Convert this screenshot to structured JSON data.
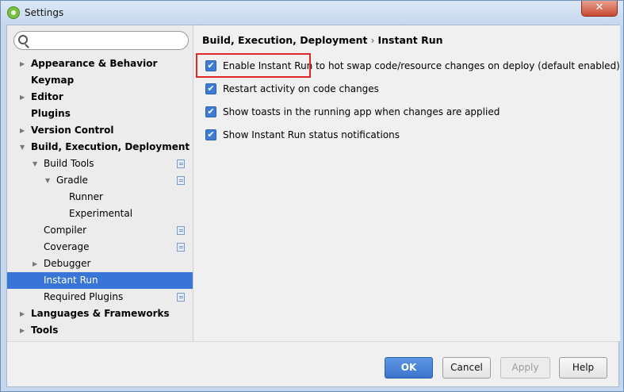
{
  "window": {
    "title": "Settings",
    "close_glyph": "✕"
  },
  "search": {
    "value": "",
    "placeholder": ""
  },
  "tree": [
    {
      "label": "Appearance & Behavior",
      "bold": true,
      "arrow": "▶",
      "indent": 0,
      "page_icon": false,
      "selected": false
    },
    {
      "label": "Keymap",
      "bold": true,
      "arrow": "",
      "indent": 0,
      "page_icon": false,
      "selected": false
    },
    {
      "label": "Editor",
      "bold": true,
      "arrow": "▶",
      "indent": 0,
      "page_icon": false,
      "selected": false
    },
    {
      "label": "Plugins",
      "bold": true,
      "arrow": "",
      "indent": 0,
      "page_icon": false,
      "selected": false
    },
    {
      "label": "Version Control",
      "bold": true,
      "arrow": "▶",
      "indent": 0,
      "page_icon": false,
      "selected": false
    },
    {
      "label": "Build, Execution, Deployment",
      "bold": true,
      "arrow": "▼",
      "indent": 0,
      "page_icon": false,
      "selected": false
    },
    {
      "label": "Build Tools",
      "bold": false,
      "arrow": "▼",
      "indent": 1,
      "page_icon": true,
      "selected": false
    },
    {
      "label": "Gradle",
      "bold": false,
      "arrow": "▼",
      "indent": 2,
      "page_icon": true,
      "selected": false
    },
    {
      "label": "Runner",
      "bold": false,
      "arrow": "",
      "indent": 3,
      "page_icon": false,
      "selected": false
    },
    {
      "label": "Experimental",
      "bold": false,
      "arrow": "",
      "indent": 3,
      "page_icon": false,
      "selected": false
    },
    {
      "label": "Compiler",
      "bold": false,
      "arrow": "",
      "indent": 1,
      "page_icon": true,
      "selected": false
    },
    {
      "label": "Coverage",
      "bold": false,
      "arrow": "",
      "indent": 1,
      "page_icon": true,
      "selected": false
    },
    {
      "label": "Debugger",
      "bold": false,
      "arrow": "▶",
      "indent": 1,
      "page_icon": false,
      "selected": false
    },
    {
      "label": "Instant Run",
      "bold": false,
      "arrow": "",
      "indent": 1,
      "page_icon": false,
      "selected": true
    },
    {
      "label": "Required Plugins",
      "bold": false,
      "arrow": "",
      "indent": 1,
      "page_icon": true,
      "selected": false
    },
    {
      "label": "Languages & Frameworks",
      "bold": true,
      "arrow": "▶",
      "indent": 0,
      "page_icon": false,
      "selected": false
    },
    {
      "label": "Tools",
      "bold": true,
      "arrow": "▶",
      "indent": 0,
      "page_icon": false,
      "selected": false
    }
  ],
  "breadcrumb": {
    "parent": "Build, Execution, Deployment",
    "separator": "›",
    "current": "Instant Run"
  },
  "options": [
    {
      "label": "Enable Instant Run to hot swap code/resource changes on deploy (default enabled)",
      "checked": true
    },
    {
      "label": "Restart activity on code changes",
      "checked": true
    },
    {
      "label": "Show toasts in the running app when changes are applied",
      "checked": true
    },
    {
      "label": "Show Instant Run status notifications",
      "checked": true
    }
  ],
  "checkmark": "✔",
  "buttons": {
    "ok": "OK",
    "cancel": "Cancel",
    "apply": "Apply",
    "help": "Help"
  },
  "colors": {
    "selection": "#3875d7",
    "checkbox": "#3d7cd6",
    "highlight_box": "#e0282a",
    "primary_button": "#3b74cc"
  }
}
